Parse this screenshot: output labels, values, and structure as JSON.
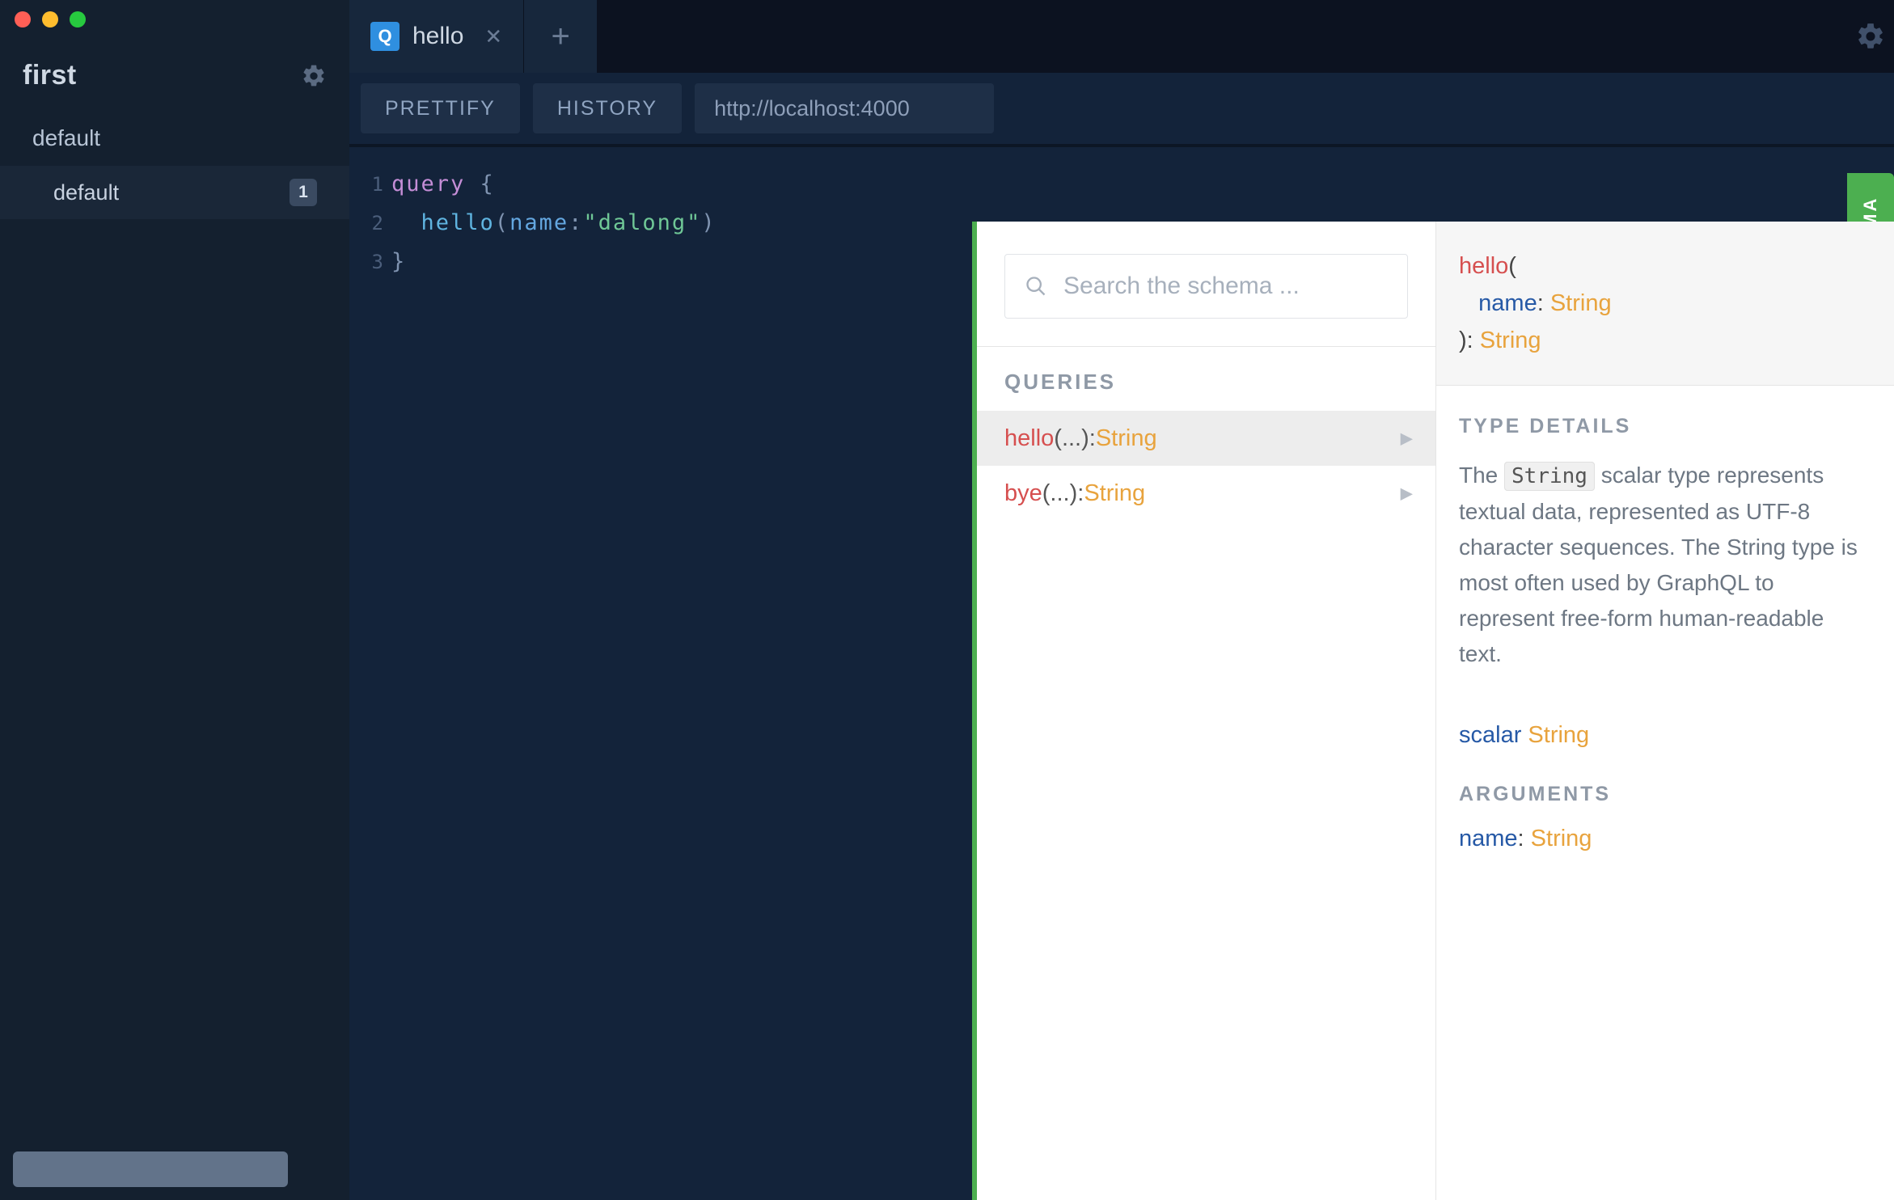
{
  "sidebar": {
    "workspace_title": "first",
    "project_label": "default",
    "history_item_label": "default",
    "history_count": "1"
  },
  "tabs": {
    "active_label": "hello",
    "q_badge": "Q"
  },
  "toolbar": {
    "prettify_label": "PRETTIFY",
    "history_label": "HISTORY",
    "endpoint": "http://localhost:4000"
  },
  "editor": {
    "line_numbers": [
      "1",
      "2",
      "3"
    ],
    "line1_keyword": "query",
    "line1_brace": "{",
    "line2_fn": "hello",
    "line2_open": "(",
    "line2_arg": "name",
    "line2_colon": ":",
    "line2_str": "\"dalong\"",
    "line2_close": ")",
    "line3_brace": "}"
  },
  "schema_tab": "SCHEMA",
  "schema_left": {
    "search_placeholder": "Search the schema ...",
    "section_title": "QUERIES",
    "rows": [
      {
        "name": "hello",
        "args": "(...): ",
        "ret": "String"
      },
      {
        "name": "bye",
        "args": "(...): ",
        "ret": "String"
      }
    ]
  },
  "schema_right": {
    "sig_field": "hello",
    "sig_open": "(",
    "sig_arg": "name",
    "sig_argcolon": ": ",
    "sig_argtype": "String",
    "sig_close": "): ",
    "sig_ret": "String",
    "type_details_title": "TYPE DETAILS",
    "type_details_text_before": "The ",
    "type_details_code": "String",
    "type_details_text_after": " scalar type represents textual data, represented as UTF-8 character sequences. The String type is most often used by GraphQL to represent free-form human-readable text.",
    "scalar_kw": "scalar",
    "scalar_ty": "String",
    "arguments_title": "ARGUMENTS",
    "argument_name": "name",
    "argument_colon": ": ",
    "argument_type": "String"
  }
}
